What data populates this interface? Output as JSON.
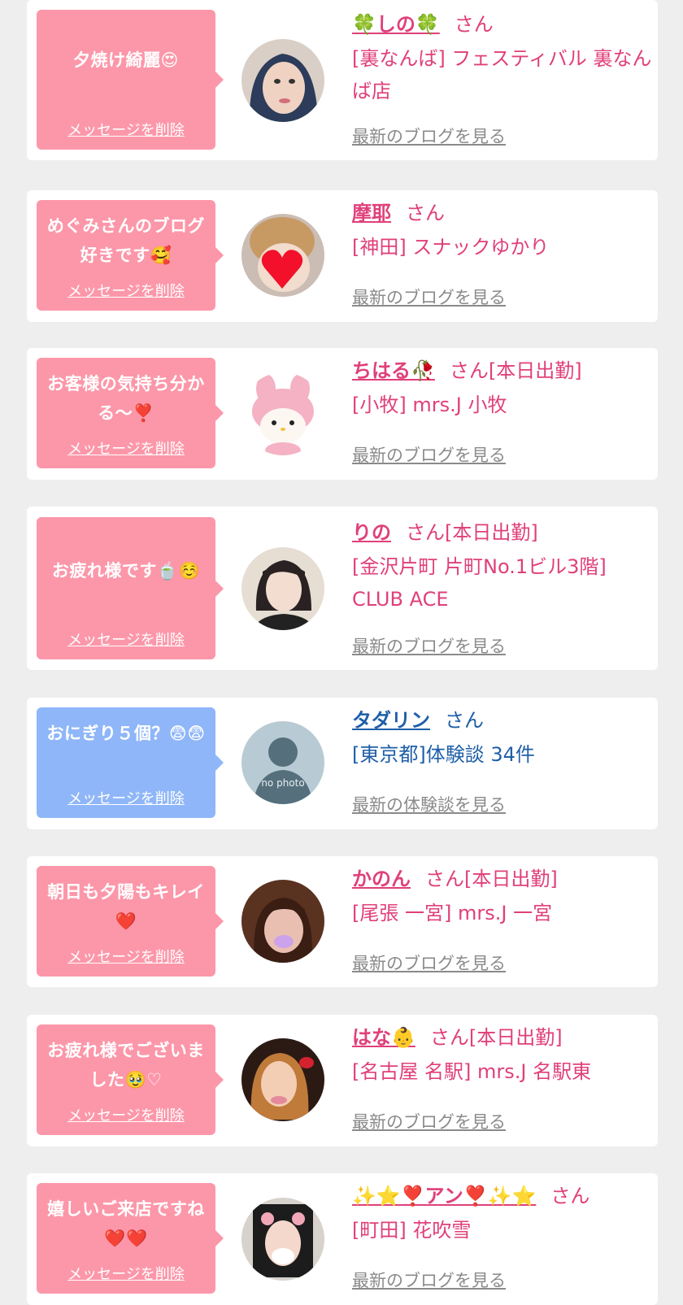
{
  "colors": {
    "pink_bubble": "#fc97a9",
    "blue_bubble": "#8fb6f8",
    "pink_text": "#e0407a",
    "blue_text": "#1f5fa8",
    "link_gray": "#8a8a8a",
    "background": "#eeeeee"
  },
  "messages": [
    {
      "message": "夕焼け綺麗😍",
      "delete_label": "メッセージを削除",
      "name": "🍀しの🍀",
      "san": "さん",
      "shop": "[裏なんば] フェスティバル 裏なんば店",
      "more_label": "最新のブログを見る",
      "theme": "pink",
      "avatar_icon": "avatar-photo-icon"
    },
    {
      "message": "めぐみさんのブログ好きです🥰",
      "delete_label": "メッセージを削除",
      "name": "摩耶",
      "san": "さん",
      "shop": "[神田] スナックゆかり",
      "more_label": "最新のブログを見る",
      "theme": "pink",
      "avatar_icon": "heart-avatar-icon"
    },
    {
      "message": "お客様の気持ち分かる〜❣️",
      "delete_label": "メッセージを削除",
      "name": "ちはる🥀",
      "san": "さん[本日出勤]",
      "shop": "[小牧] mrs.J 小牧",
      "more_label": "最新のブログを見る",
      "theme": "pink",
      "avatar_icon": "plush-toy-avatar-icon"
    },
    {
      "message": "お疲れ様です🍵☺️",
      "delete_label": "メッセージを削除",
      "name": "りの",
      "san": "さん[本日出勤]",
      "shop": "[金沢片町 片町No.1ビル3階] CLUB ACE",
      "more_label": "最新のブログを見る",
      "theme": "pink",
      "avatar_icon": "avatar-photo-icon"
    },
    {
      "message": "おにぎり５個？😨😨",
      "delete_label": "メッセージを削除",
      "name": "タダリン",
      "san": "さん",
      "shop": "[東京都]体験談 34件",
      "more_label": "最新の体験談を見る",
      "theme": "blue",
      "avatar_icon": "no-photo-avatar-icon",
      "avatar_text": "no photo"
    },
    {
      "message": "朝日も夕陽もキレイ❤️",
      "delete_label": "メッセージを削除",
      "name": "かのん",
      "san": "さん[本日出勤]",
      "shop": "[尾張 一宮] mrs.J 一宮",
      "more_label": "最新のブログを見る",
      "theme": "pink",
      "avatar_icon": "avatar-photo-icon"
    },
    {
      "message": "お疲れ様でございました🥹♡",
      "delete_label": "メッセージを削除",
      "name": "はな👶",
      "san": "さん[本日出勤]",
      "shop": "[名古屋 名駅] mrs.J 名駅東",
      "more_label": "最新のブログを見る",
      "theme": "pink",
      "avatar_icon": "avatar-photo-icon"
    },
    {
      "message": "嬉しいご来店ですね❤️❤️",
      "delete_label": "メッセージを削除",
      "name": "✨⭐❣️アン❣️✨⭐",
      "san": "さん",
      "shop": "[町田] 花吹雪",
      "more_label": "最新のブログを見る",
      "theme": "pink",
      "avatar_icon": "avatar-photo-icon"
    }
  ]
}
